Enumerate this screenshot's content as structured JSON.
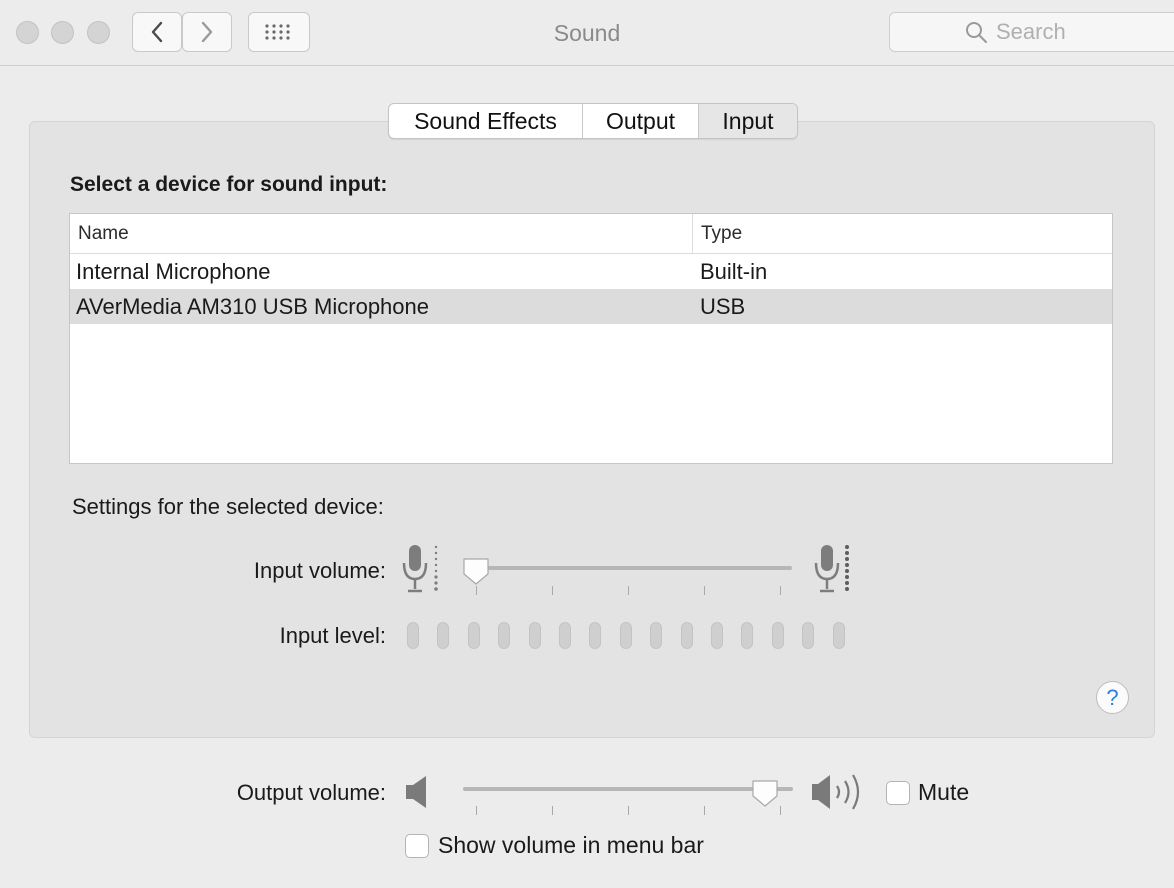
{
  "window": {
    "title": "Sound"
  },
  "toolbar": {
    "search_placeholder": "Search",
    "icons": [
      "back-chevron-icon",
      "forward-chevron-icon",
      "grid-icon",
      "search-icon"
    ]
  },
  "tabs": [
    {
      "label": "Sound Effects",
      "active": false
    },
    {
      "label": "Output",
      "active": false
    },
    {
      "label": "Input",
      "active": true
    }
  ],
  "input": {
    "section_title": "Select a device for sound input:",
    "columns": {
      "name": "Name",
      "type": "Type"
    },
    "devices": [
      {
        "name": "Internal Microphone",
        "type": "Built-in",
        "selected": false
      },
      {
        "name": "AVerMedia AM310 USB Microphone",
        "type": "USB",
        "selected": true
      }
    ],
    "settings_label": "Settings for the selected device:",
    "volume_label": "Input volume:",
    "volume_value": 0.0,
    "level_label": "Input level:",
    "level_segments": 15,
    "level_value": 0
  },
  "output": {
    "volume_label": "Output volume:",
    "volume_value": 0.95,
    "mute_label": "Mute",
    "mute_checked": false,
    "show_volume_label": "Show volume in menu bar",
    "show_volume_checked": false
  },
  "help": {
    "glyph": "?"
  },
  "colors": {
    "accent": "#2a7de1",
    "selected_row": "#dcdcdc"
  }
}
